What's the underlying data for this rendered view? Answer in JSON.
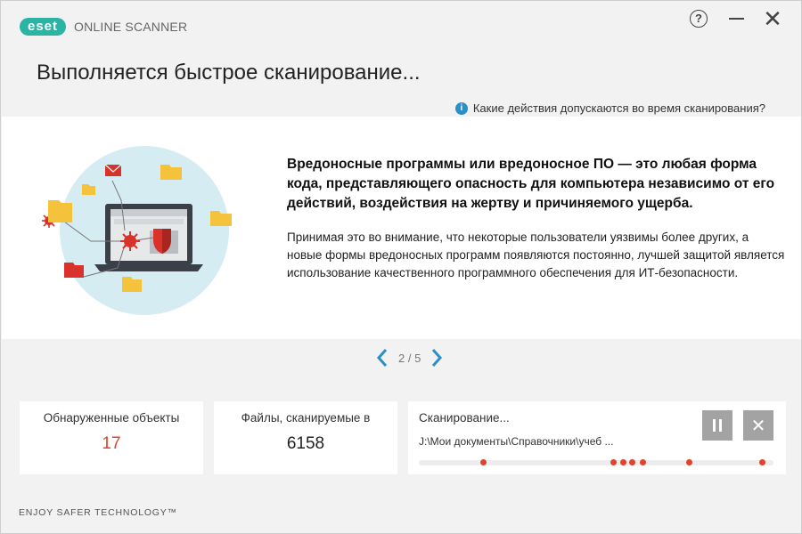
{
  "titlebar": {
    "logo_text": "eset",
    "product_name": "ONLINE SCANNER",
    "help_label": "?",
    "close_label": "✕"
  },
  "page": {
    "title": "Выполняется быстрое сканирование...",
    "info_link": "Какие действия допускаются во время сканирования?"
  },
  "content": {
    "headline": "Вредоносные программы или вредоносное ПО — это любая форма кода, представляющего опасность для компьютера независимо от его действий, воздействия на жертву и причиняемого ущерба.",
    "paragraph": "Принимая это во внимание, что некоторые пользователи уязвимы более других, а новые формы вредоносных программ появляются постоянно, лучшей защитой является использование качественного программного обеспечения для ИТ-безопасности."
  },
  "pager": {
    "text": "2 / 5"
  },
  "stats": {
    "detected_label": "Обнаруженные объекты",
    "detected_value": "17",
    "files_label": "Файлы, сканируемые в",
    "files_value": "6158",
    "scan_label": "Сканирование...",
    "scan_path": "J:\\Мои документы\\Справочники\\учеб ...",
    "stop_label": "✕"
  },
  "footer": {
    "slogan": "ENJOY SAFER TECHNOLOGY™"
  },
  "colors": {
    "brand": "#2bb3a3",
    "accent": "#2c8fc8",
    "alert": "#e0432c",
    "button_gray": "#a3a3a3"
  },
  "icons": [
    "help-icon",
    "minimize-icon",
    "close-icon",
    "info-icon",
    "chevron-left-icon",
    "chevron-right-icon",
    "pause-icon",
    "stop-icon"
  ]
}
